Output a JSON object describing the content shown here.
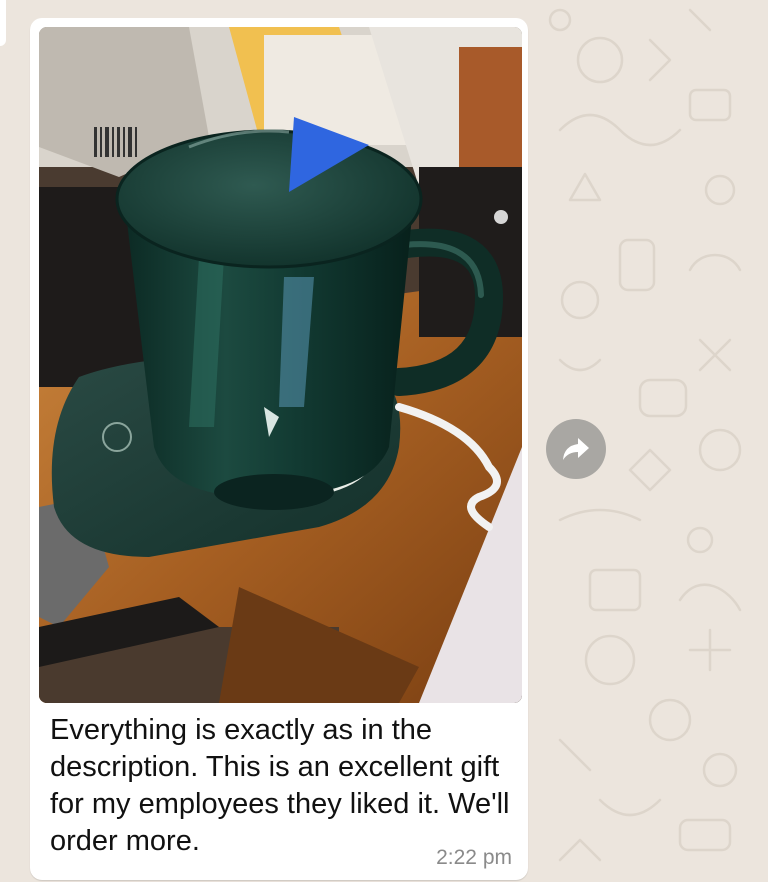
{
  "message": {
    "caption": "Everything is exactly as in the description. This is an excellent gift for my employees they liked it. We'll order more.",
    "timestamp": "2:22 pm"
  },
  "photo": {
    "subject": "green mug with lid on a warming coaster"
  },
  "icons": {
    "forward": "forward-arrow-icon"
  },
  "colors": {
    "chat_background": "#ece5dd",
    "bubble": "#ffffff",
    "timestamp": "#8a8a8a",
    "forward_button": "#a9a7a3"
  }
}
